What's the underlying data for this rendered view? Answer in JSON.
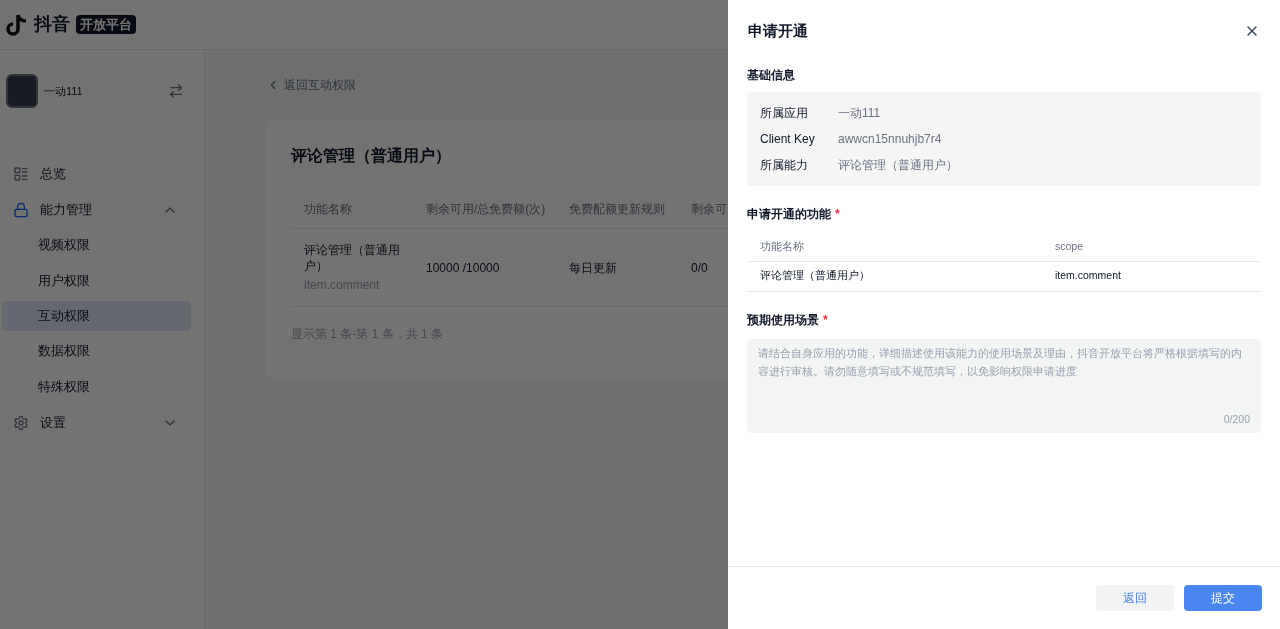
{
  "header": {
    "logo_text": "抖音",
    "logo_badge": "开放平台"
  },
  "sidebar": {
    "app_name": "一动111",
    "items": [
      {
        "label": "总览",
        "selected": false
      },
      {
        "label": "能力管理",
        "expanded": true,
        "selected": false,
        "children": [
          {
            "label": "视频权限",
            "selected": false
          },
          {
            "label": "用户权限",
            "selected": false
          },
          {
            "label": "互动权限",
            "selected": true
          },
          {
            "label": "数据权限",
            "selected": false
          },
          {
            "label": "特殊权限",
            "selected": false
          }
        ]
      },
      {
        "label": "设置",
        "expanded": false,
        "selected": false
      }
    ]
  },
  "main": {
    "back_link": "返回互动权限",
    "card_title": "评论管理（普通用户）",
    "table": {
      "columns": [
        "功能名称",
        "剩余可用/总免费额(次)",
        "免费配额更新规则",
        "剩余可"
      ],
      "rows": [
        {
          "name": "评论管理（普通用户）",
          "scope": "item.comment",
          "quota": "10000 /10000",
          "rule": "每日更新",
          "column_4": "0/0"
        }
      ]
    },
    "pagination": "显示第 1 条-第 1 条，共 1 条"
  },
  "drawer": {
    "title": "申请开通",
    "basic_info": {
      "heading": "基础信息",
      "fields": [
        {
          "label": "所属应用",
          "value": "一动111"
        },
        {
          "label": "Client Key",
          "value": "awwcn15nnuhjb7r4"
        },
        {
          "label": "所属能力",
          "value": "评论管理（普通用户）"
        }
      ]
    },
    "features": {
      "heading": "申请开通的功能",
      "required_mark": "*",
      "columns": [
        "功能名称",
        "scope"
      ],
      "rows": [
        [
          "评论管理（普通用户）",
          "item.comment"
        ]
      ]
    },
    "scenario": {
      "heading": "预期使用场景",
      "required_mark": "*",
      "placeholder": "请结合自身应用的功能，详细描述使用该能力的使用场景及理由，抖音开放平台将严格根据填写的内容进行审核。请勿随意填写或不规范填写，以免影响权限申请进度",
      "counter": "0/200"
    },
    "buttons": [
      {
        "label": "返回",
        "kind": "secondary"
      },
      {
        "label": "提交",
        "kind": "primary"
      }
    ]
  }
}
